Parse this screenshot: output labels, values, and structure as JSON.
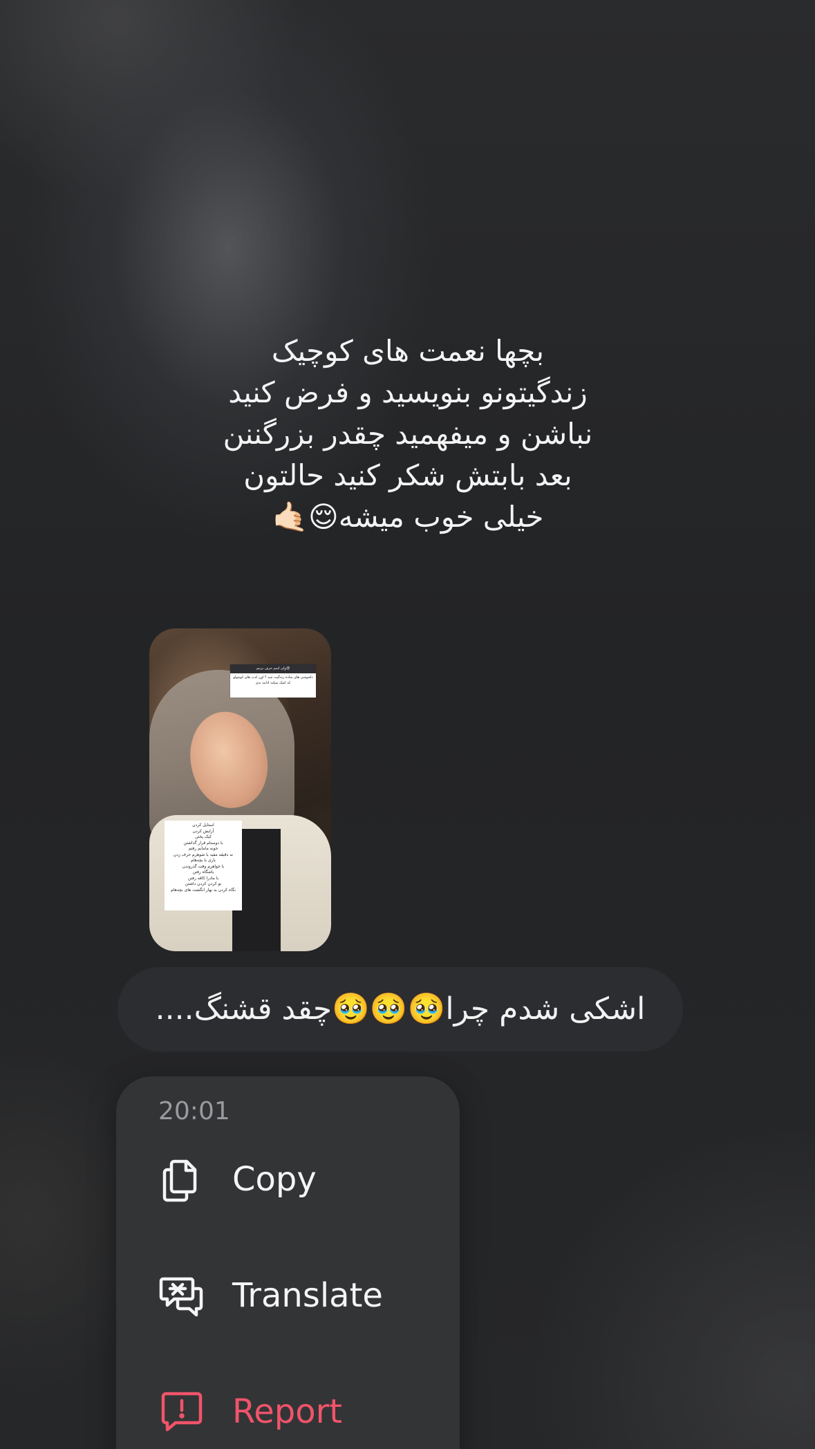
{
  "story": {
    "caption_lines": [
      "بچها نعمت های کوچیک",
      "زندگیتونو بنویسید و فرض کنید",
      "نباشن و میفهمید چقدر بزرگننن",
      "بعد بابتش شکر کنید حالتون",
      "خیلی خوب میشه😌🤙🏻"
    ],
    "thumbnail": {
      "top_card_header": "ولی اسم حرف بزنیم😍",
      "top_card_text": "دلخوشی های ساده زندگیت چیه ؟ اون لذت های کوچولو که کمک میکنه ادامه بدی",
      "bottom_card_lines": [
        "استایل کردن",
        "آرایش کردن",
        "کیک پختن",
        "با دوستام قرار گذاشتن",
        "خونه مامانم رفتم",
        "نه دقیقه مفید با شوهرم حرف زدن",
        "بازی با بچه‌هام",
        "با خواهرم وقت گذروندن",
        "باشگاه رفتن",
        "با مادرا کافه رفتن",
        "نو کردن کردن داشتن",
        "نگاه کردن به بهار انگشت های بچه‌هام"
      ]
    }
  },
  "reply": {
    "text": "اشکی شدم چرا🥹🥹🥹چقد قشنگ...."
  },
  "menu": {
    "time": "20:01",
    "items": [
      {
        "label": "Copy",
        "icon": "copy-icon"
      },
      {
        "label": "Translate",
        "icon": "translate-icon"
      },
      {
        "label": "Report",
        "icon": "report-icon",
        "color": "#f0546a"
      }
    ]
  }
}
